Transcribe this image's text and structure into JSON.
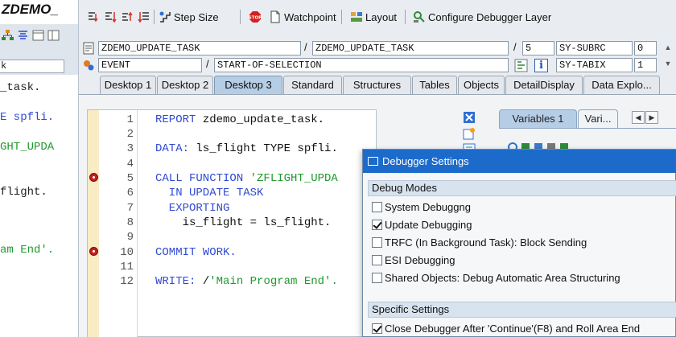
{
  "left_window": {
    "title": "ZDEMO_",
    "field_value": "k",
    "code_lines": [
      {
        "text": "_task.",
        "color": "#111111"
      },
      {
        "text": "E spfli.",
        "color": "#2f4ad0"
      },
      {
        "text": "GHT_UPDA",
        "color": "#1f9a2d"
      },
      {
        "text": "flight.",
        "color": "#111111"
      },
      {
        "text": "am End'.",
        "color": "#1f9a2d"
      }
    ]
  },
  "toolbar": {
    "step_size": "Step Size",
    "watchpoint": "Watchpoint",
    "layout": "Layout",
    "configure": "Configure Debugger Layer"
  },
  "status": {
    "program": "ZDEMO_UPDATE_TASK",
    "include": "ZDEMO_UPDATE_TASK",
    "line": "5",
    "sy_subrc_label": "SY-SUBRC",
    "sy_subrc_value": "0",
    "event_type": "EVENT",
    "event_name": "START-OF-SELECTION",
    "sy_tabix_label": "SY-TABIX",
    "sy_tabix_value": "1",
    "info_icon_label": "i"
  },
  "tabs": [
    {
      "label": "Desktop 1",
      "active": false
    },
    {
      "label": "Desktop 2",
      "active": false
    },
    {
      "label": "Desktop 3",
      "active": true
    },
    {
      "label": "Standard",
      "active": false
    },
    {
      "label": "Structures",
      "active": false
    },
    {
      "label": "Tables",
      "active": false
    },
    {
      "label": "Objects",
      "active": false
    },
    {
      "label": "DetailDisplay",
      "active": false
    },
    {
      "label": "Data Explo...",
      "active": false
    }
  ],
  "editor": {
    "line_numbers": [
      "1",
      "2",
      "3",
      "4",
      "5",
      "6",
      "7",
      "8",
      "9",
      "10",
      "11",
      "12"
    ],
    "breakpoint_lines": [
      5,
      10
    ],
    "lines": [
      {
        "kw": "REPORT",
        "rest": " zdemo_update_task."
      },
      {
        "kw": "DATA:",
        "rest": " ls_flight TYPE spfli."
      },
      {
        "kw": "CALL FUNCTION",
        "str": " 'ZFLIGHT_UPDA"
      },
      {
        "kw": "  IN UPDATE TASK"
      },
      {
        "kw": "  EXPORTING"
      },
      {
        "rest": "    is_flight = ls_flight."
      },
      {
        "kw": "COMMIT WORK."
      },
      {
        "kw": "WRITE:",
        "rest": " /",
        "str": "'Main Program End'."
      }
    ]
  },
  "variables_panel": {
    "tab1": "Variables 1",
    "tab2": "Vari...",
    "prev": "◀",
    "next": "▶"
  },
  "dialog": {
    "title": "Debugger Settings",
    "debug_modes_header": "Debug Modes",
    "options": [
      {
        "label": "System Debuggng",
        "checked": false
      },
      {
        "label": "Update Debugging",
        "checked": true
      },
      {
        "label": "TRFC (In Background Task): Block Sending",
        "checked": false
      },
      {
        "label": "ESI Debugging",
        "checked": false
      },
      {
        "label": "Shared Objects: Debug Automatic Area Structuring",
        "checked": false
      }
    ],
    "specific_header": "Specific Settings",
    "specific_options": [
      {
        "label": "Close Debugger After 'Continue'(F8) and Roll Area End",
        "checked": true
      }
    ]
  },
  "colors": {
    "keyword": "#2f4ad0",
    "string": "#1f9a2d",
    "dialog_title": "#1c6bcb",
    "active_tab": "#b6cde6",
    "annotation_arrow": "#e8403b"
  }
}
